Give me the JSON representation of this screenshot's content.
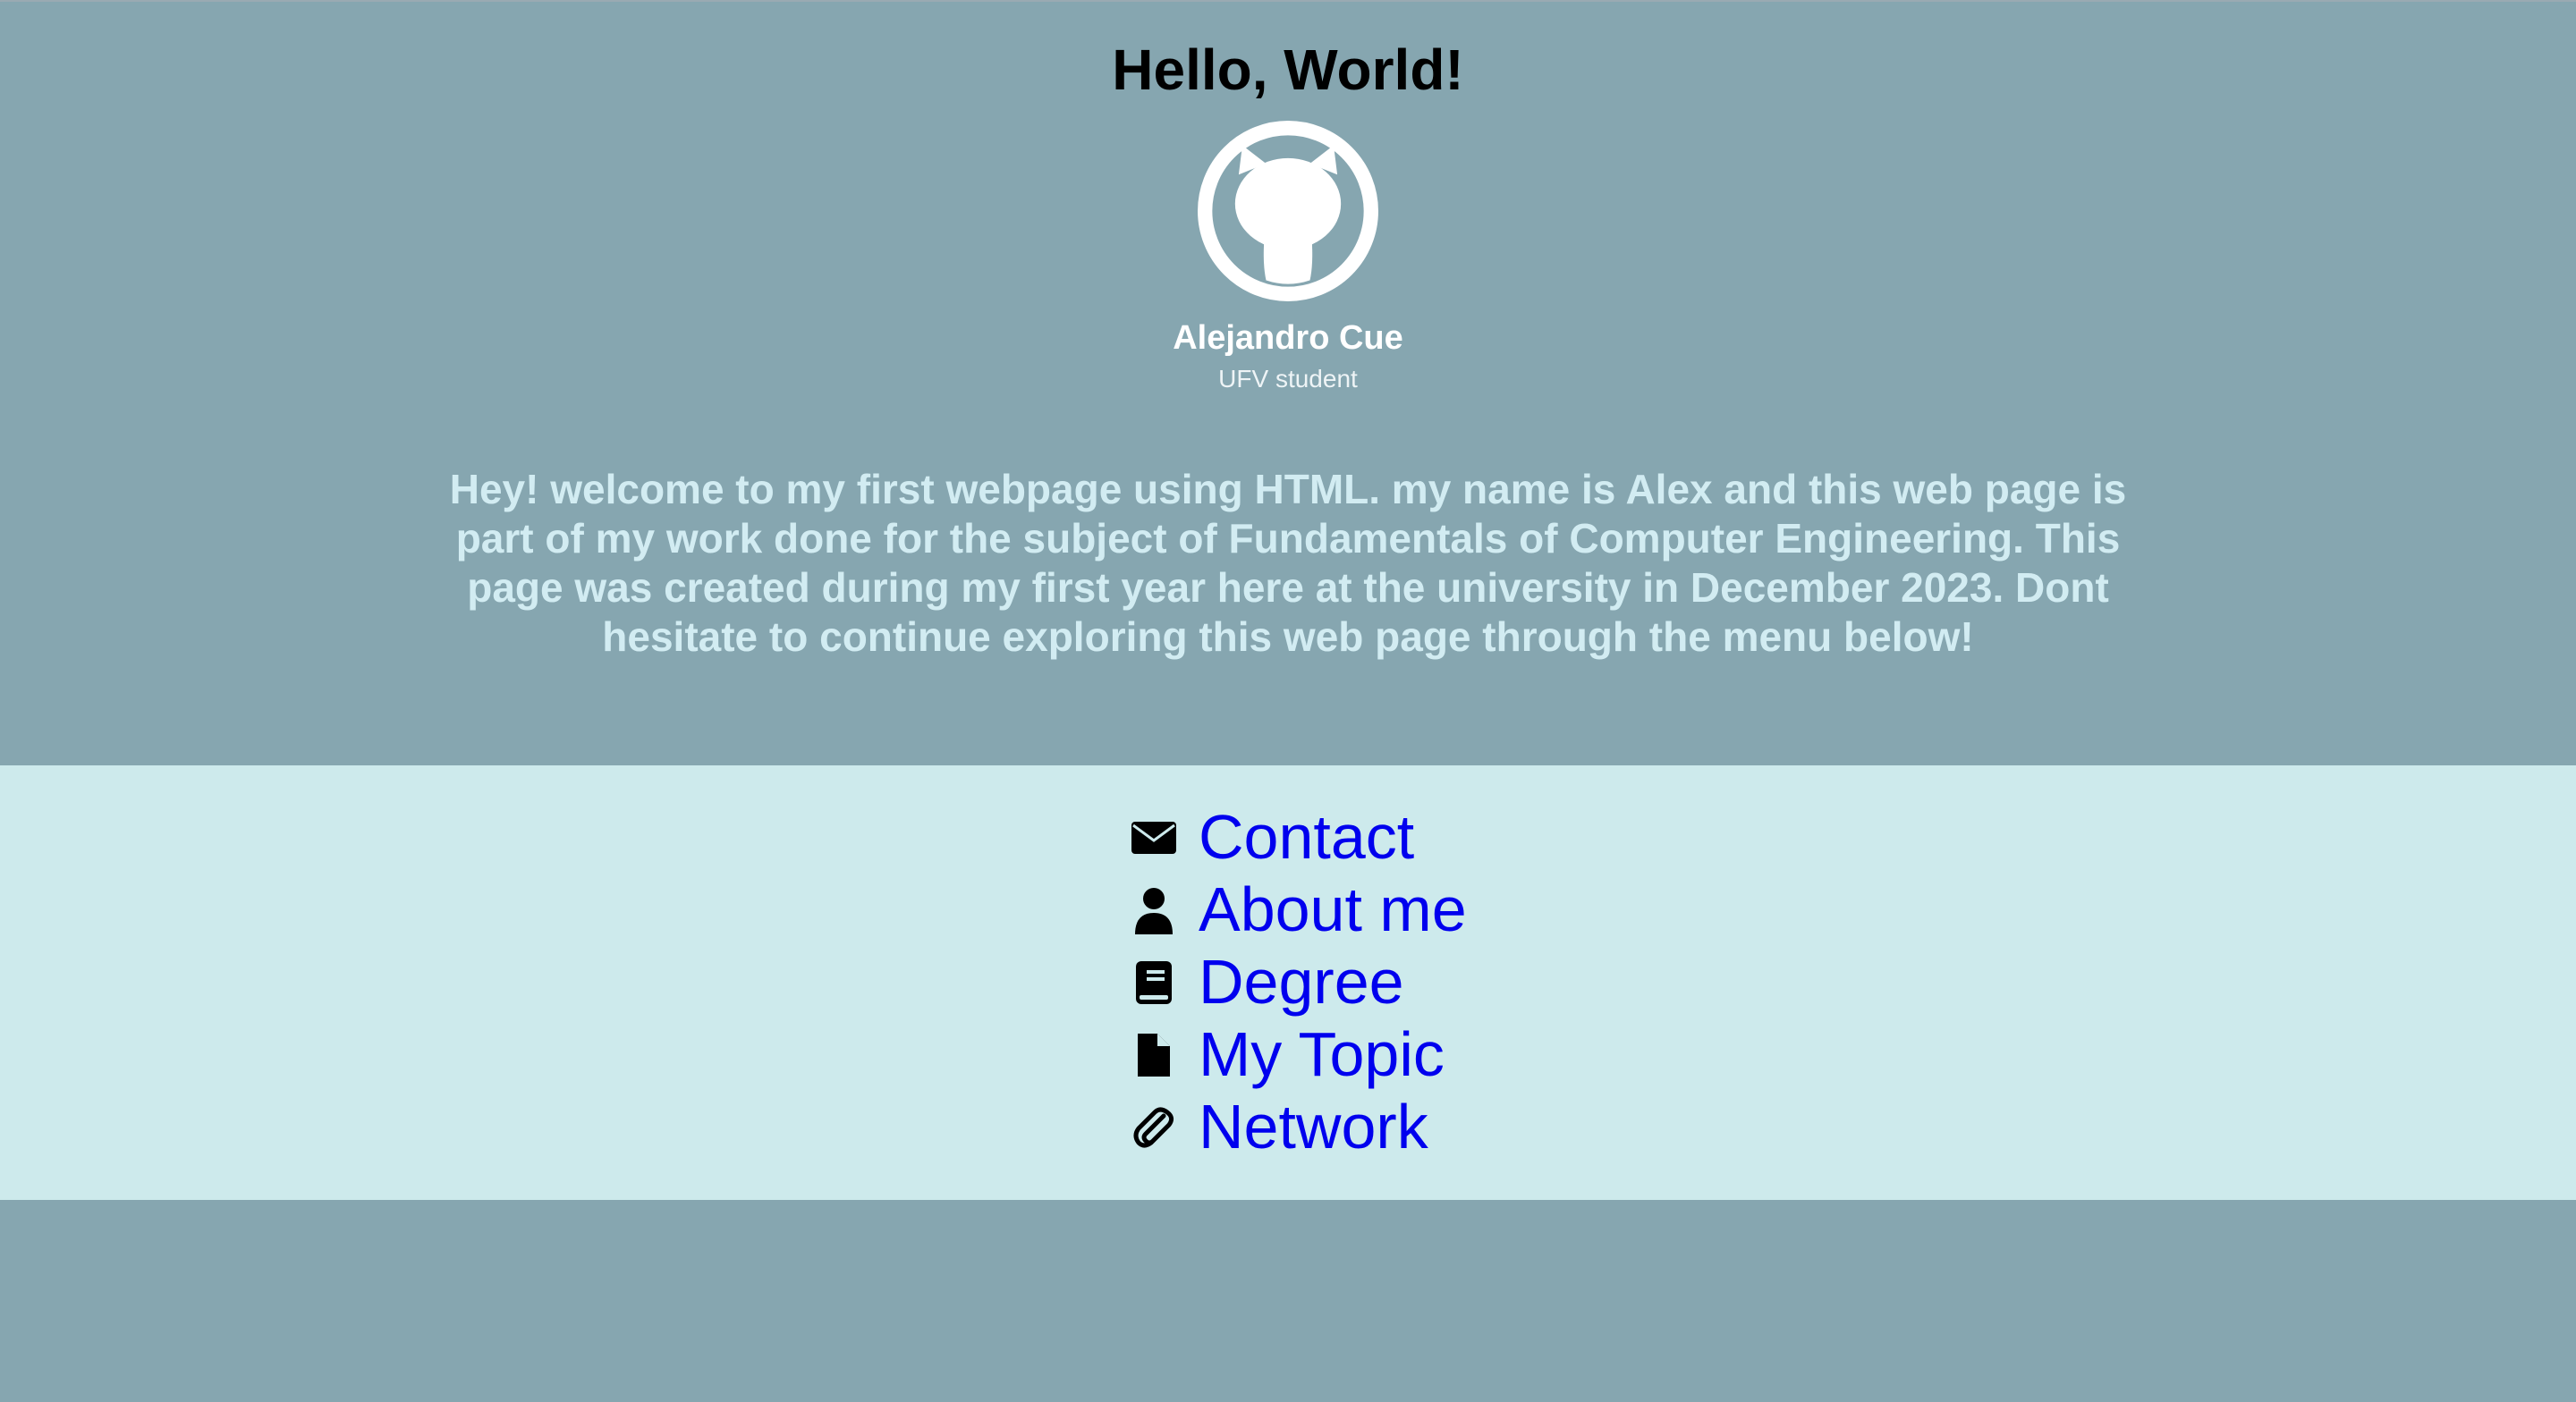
{
  "header": {
    "title": "Hello, World!",
    "avatar_icon": "github-octocat-icon",
    "profile_name": "Alejandro Cue",
    "profile_role": "UFV student",
    "intro": "Hey! welcome to my first webpage using HTML. my name is Alex and this web page is part of my work done for the subject of Fundamentals of Computer Engineering. This page was created during my first year here at the university in December 2023. Dont hesitate to continue exploring this web page through the menu below!"
  },
  "menu": {
    "items": [
      {
        "label": "Contact",
        "icon": "envelope-icon"
      },
      {
        "label": "About me",
        "icon": "user-icon"
      },
      {
        "label": "Degree",
        "icon": "book-icon"
      },
      {
        "label": "My Topic",
        "icon": "file-icon"
      },
      {
        "label": "Network",
        "icon": "paperclip-icon"
      }
    ]
  },
  "colors": {
    "page_background": "#86a6b0",
    "menu_background": "#cdeaec",
    "intro_text": "#d2ecf2",
    "link": "#0000ee"
  }
}
